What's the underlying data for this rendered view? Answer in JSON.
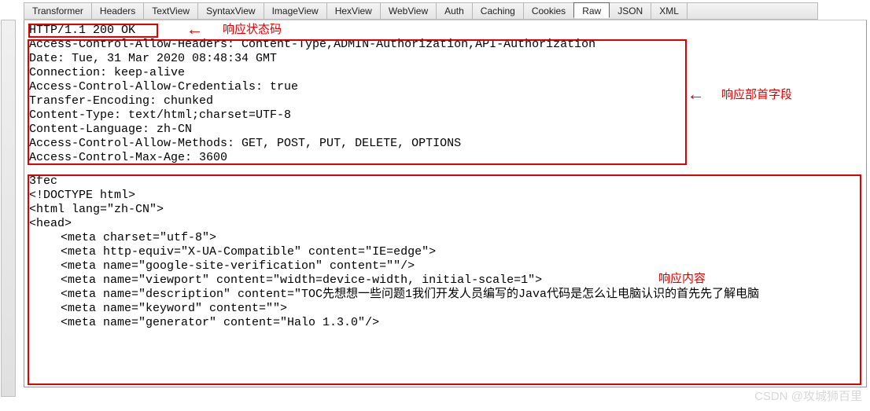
{
  "tabs": {
    "items": [
      "Transformer",
      "Headers",
      "TextView",
      "SyntaxView",
      "ImageView",
      "HexView",
      "WebView",
      "Auth",
      "Caching",
      "Cookies",
      "Raw",
      "JSON",
      "XML"
    ],
    "active_index": 10
  },
  "response": {
    "status_line": "HTTP/1.1 200 OK",
    "headers": [
      "Access-Control-Allow-Headers: Content-Type,ADMIN-Authorization,API-Authorization",
      "Date: Tue, 31 Mar 2020 08:48:34 GMT",
      "Connection: keep-alive",
      "Access-Control-Allow-Credentials: true",
      "Transfer-Encoding: chunked",
      "Content-Type: text/html;charset=UTF-8",
      "Content-Language: zh-CN",
      "Access-Control-Allow-Methods: GET, POST, PUT, DELETE, OPTIONS",
      "Access-Control-Max-Age: 3600"
    ],
    "body_lines": [
      "3fec",
      "<!DOCTYPE html>",
      "<html lang=\"zh-CN\">",
      "",
      "<head>"
    ],
    "body_meta": [
      "<meta charset=\"utf-8\">",
      "<meta http-equiv=\"X-UA-Compatible\" content=\"IE=edge\">",
      "<meta name=\"google-site-verification\" content=\"\"/>",
      "<meta name=\"viewport\" content=\"width=device-width, initial-scale=1\">",
      "<meta name=\"description\" content=\"TOC先想想一些问题1我们开发人员编写的Java代码是怎么让电脑认识的首先先了解电脑",
      "<meta name=\"keyword\" content=\"\">",
      "<meta name=\"generator\" content=\"Halo 1.3.0\"/>"
    ]
  },
  "annotations": {
    "status": "响应状态码",
    "headers": "响应部首字段",
    "body": "响应内容",
    "arrow": "←"
  },
  "watermark": "CSDN @攻城狮百里"
}
